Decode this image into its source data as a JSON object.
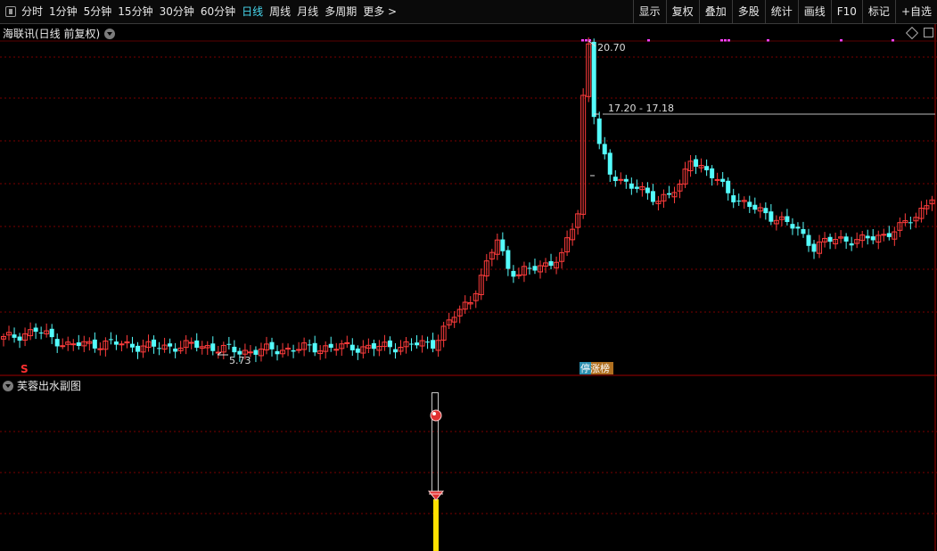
{
  "toolbar": {
    "periods": [
      "分时",
      "1分钟",
      "5分钟",
      "15分钟",
      "30分钟",
      "60分钟",
      "日线",
      "周线",
      "月线",
      "多周期",
      "更多"
    ],
    "active_period": "日线",
    "more_arrow": ">",
    "buttons": [
      "显示",
      "复权",
      "叠加",
      "多股",
      "统计",
      "画线",
      "F10",
      "标记",
      "+自选"
    ]
  },
  "main_chart": {
    "title": "海联讯(日线 前复权)",
    "high_label": "20.70",
    "range_label": "17.20 - 17.18",
    "low_label": "5.73",
    "badge_text": "停涨榜",
    "marker": "S",
    "colors": {
      "up": "#ff3c3c",
      "down": "#54fcfc",
      "grid": "#7a0000",
      "signal": "#ff40ff"
    }
  },
  "sub_chart": {
    "title": "芙蓉出水副图",
    "colors": {
      "bar": "#ffe000",
      "outline": "#c8c8c8"
    }
  },
  "chart_data": {
    "type": "candlestick",
    "title": "海联讯(日线 前复权)",
    "annotations": [
      "20.70",
      "17.20 - 17.18",
      "5.73"
    ],
    "max_price": 20.7,
    "min_price": 5.73
  }
}
